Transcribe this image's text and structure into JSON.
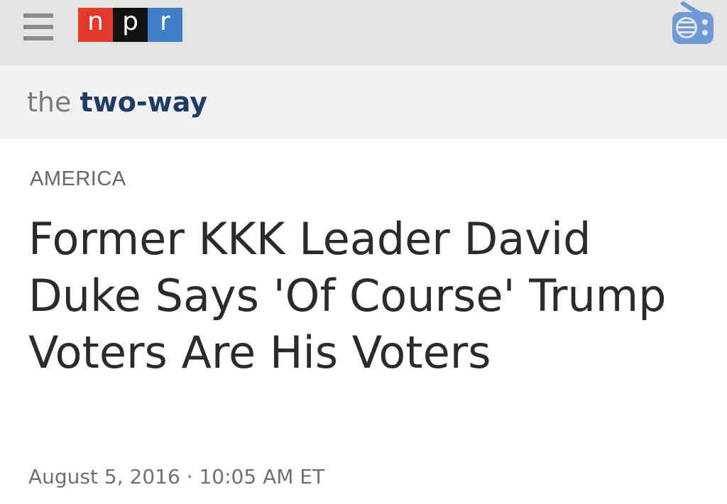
{
  "header": {
    "logo_letters": [
      "n",
      "p",
      "r"
    ],
    "menu_icon": "hamburger-menu-icon",
    "radio_icon": "radio-icon",
    "colors": {
      "bar_bg": "#e4e4e4",
      "logo_n": "#e3392b",
      "logo_p": "#111111",
      "logo_r": "#3f7fc6",
      "radio": "#6e9bd8"
    }
  },
  "section": {
    "prefix": "the",
    "name": "two-way"
  },
  "article": {
    "category": "AMERICA",
    "headline": "Former KKK Leader David Duke Says 'Of Course' Trump Voters Are His Voters",
    "date": "August 5, 2016",
    "separator": "·",
    "time": "10:05 AM ET"
  }
}
